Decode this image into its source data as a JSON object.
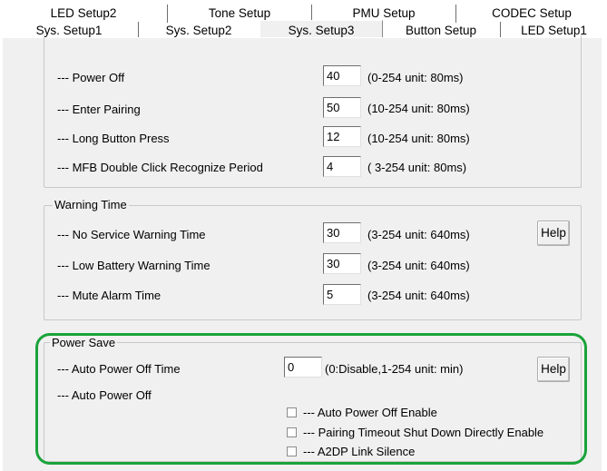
{
  "tabs": {
    "row1": [
      {
        "label": "LED Setup2"
      },
      {
        "label": "Tone Setup"
      },
      {
        "label": "PMU Setup"
      },
      {
        "label": "CODEC Setup"
      }
    ],
    "row2": [
      {
        "label": "Sys. Setup1"
      },
      {
        "label": "Sys. Setup2"
      },
      {
        "label": "Sys. Setup3",
        "selected": true
      },
      {
        "label": "Button Setup"
      },
      {
        "label": "LED Setup1"
      }
    ]
  },
  "button_timing": {
    "rows": [
      {
        "label": "--- Power Off",
        "value": "40",
        "unit": "(0-254 unit: 80ms)"
      },
      {
        "label": "--- Enter Pairing",
        "value": "50",
        "unit": "(10-254 unit: 80ms)"
      },
      {
        "label": "--- Long Button Press",
        "value": "12",
        "unit": "(10-254 unit: 80ms)"
      },
      {
        "label": "--- MFB Double Click Recognize Period",
        "value": "4",
        "unit": "( 3-254 unit: 80ms)"
      }
    ]
  },
  "warning_time": {
    "title": "Warning Time",
    "help_label": "Help",
    "rows": [
      {
        "label": "--- No Service Warning Time",
        "value": "30",
        "unit": "(3-254 unit: 640ms)"
      },
      {
        "label": "--- Low Battery Warning Time",
        "value": "30",
        "unit": "(3-254 unit: 640ms)"
      },
      {
        "label": "--- Mute Alarm Time",
        "value": "5",
        "unit": "(3-254 unit: 640ms)"
      }
    ]
  },
  "power_save": {
    "title": "Power Save",
    "help_label": "Help",
    "auto_off_time": {
      "label": "--- Auto Power Off Time",
      "value": "0",
      "unit": "(0:Disable,1-254 unit: min)"
    },
    "auto_off_label": "--- Auto Power Off",
    "checkboxes": [
      {
        "label": "--- Auto Power Off Enable",
        "checked": false
      },
      {
        "label": "--- Pairing Timeout Shut Down Directly Enable",
        "checked": false
      },
      {
        "label": "--- A2DP Link Silence",
        "checked": false
      }
    ]
  },
  "colors": {
    "highlight": "#1aa33a",
    "panel": "#f0f0f0"
  }
}
